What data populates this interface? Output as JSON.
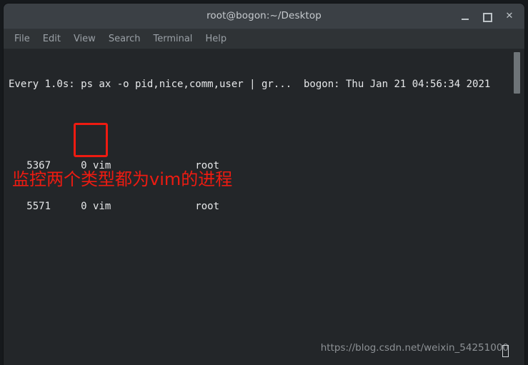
{
  "window": {
    "title": "root@bogon:~/Desktop",
    "controls": {
      "minimize": "_",
      "maximize": "□",
      "close": "✕"
    }
  },
  "menu": {
    "items": [
      {
        "label": "File"
      },
      {
        "label": "Edit"
      },
      {
        "label": "View"
      },
      {
        "label": "Search"
      },
      {
        "label": "Terminal"
      },
      {
        "label": "Help"
      }
    ]
  },
  "terminal": {
    "watch_header": "Every 1.0s: ps ax -o pid,nice,comm,user | gr...  bogon: Thu Jan 21 04:56:34 2021",
    "rows": [
      {
        "pid": "5367",
        "nice": "0",
        "comm": "vim",
        "user": "root"
      },
      {
        "pid": "5571",
        "nice": "0",
        "comm": "vim",
        "user": "root"
      }
    ],
    "row_lines": [
      "   5367     0 vim              root",
      "   5571     0 vim              root"
    ]
  },
  "annotations": {
    "note_text": "监控两个类型都为vim的进程",
    "note_color": "#ee1b11",
    "highlight_color": "#ee1b11"
  },
  "watermark": {
    "url": "https://blog.csdn.net/weixin_54251000"
  },
  "colors": {
    "titlebar_bg": "#3b4045",
    "menubar_bg": "#2f3336",
    "terminal_bg": "#232629",
    "terminal_fg": "#e6e8ea",
    "menu_fg": "#9aa0a6",
    "scrollbar_thumb": "#6e7478"
  }
}
